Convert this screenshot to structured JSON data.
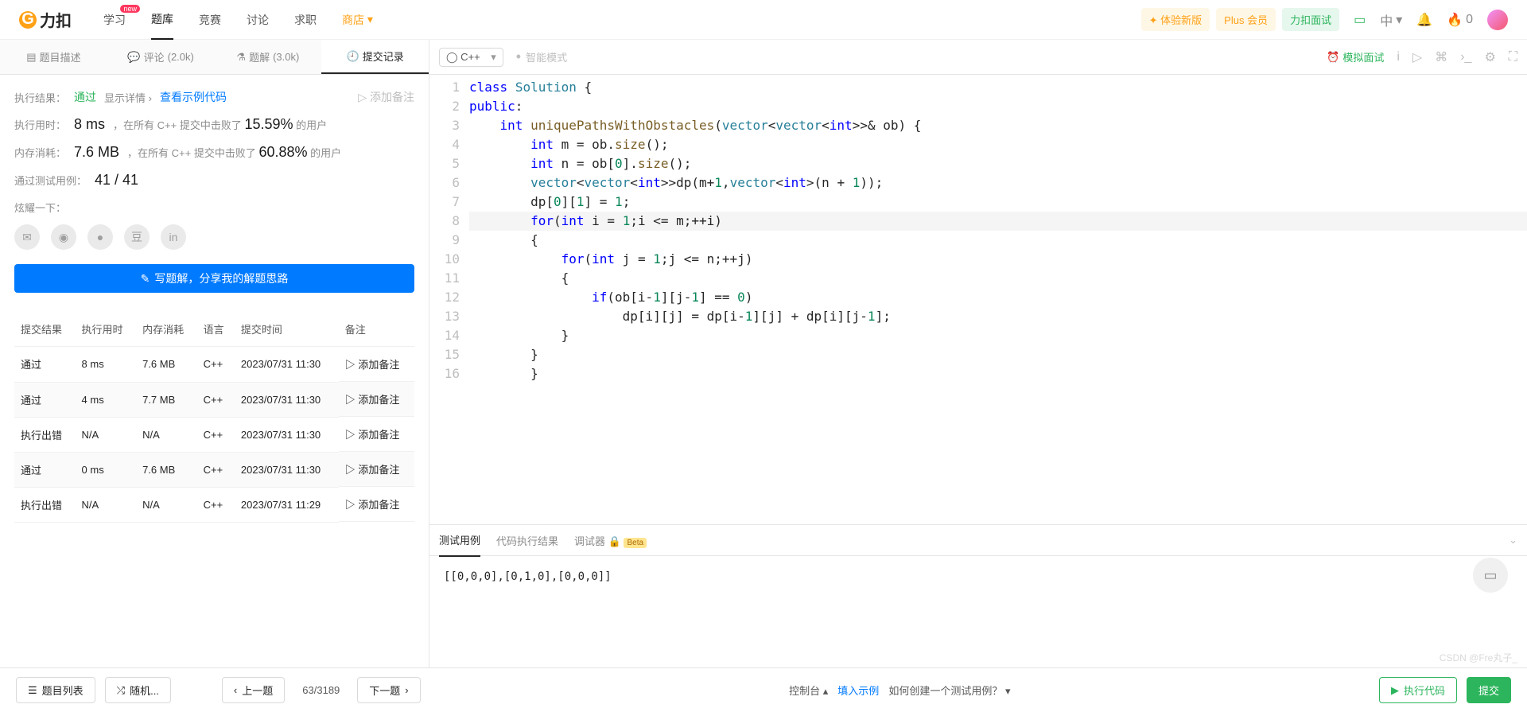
{
  "nav": {
    "logo": "力扣",
    "items": [
      "学习",
      "题库",
      "竞赛",
      "讨论",
      "求职",
      "商店"
    ],
    "badge_new": "new",
    "store_caret": "▾",
    "trial": "体验新版",
    "plus": "Plus 会员",
    "interview": "力扣面试",
    "lang": "中",
    "fire": "0"
  },
  "left_tabs": {
    "desc": "题目描述",
    "comment": "评论",
    "comment_count": "(2.0k)",
    "solution": "题解",
    "solution_count": "(3.0k)",
    "submissions": "提交记录"
  },
  "result": {
    "label_result": "执行结果：",
    "value_result": "通过",
    "show_detail": "显示详情",
    "example_code": "查看示例代码",
    "add_note_top": "添加备注",
    "label_time": "执行用时：",
    "time": "8 ms",
    "time_text_a": "，在所有 C++ 提交中击败了",
    "time_pct": "15.59%",
    "time_text_b": "的用户",
    "label_memory": "内存消耗：",
    "memory": "7.6 MB",
    "mem_text_a": "，在所有 C++ 提交中击败了",
    "mem_pct": "60.88%",
    "mem_text_b": "的用户",
    "label_tests": "通过测试用例：",
    "tests": "41 / 41",
    "show_off": "炫耀一下：",
    "write_solution": "写题解，分享我的解题思路"
  },
  "table": {
    "headers": [
      "提交结果",
      "执行用时",
      "内存消耗",
      "语言",
      "提交时间",
      "备注"
    ],
    "rows": [
      {
        "status": "通过",
        "ok": true,
        "time": "8 ms",
        "mem": "7.6 MB",
        "lang": "C++",
        "ts": "2023/07/31 11:30"
      },
      {
        "status": "通过",
        "ok": true,
        "time": "4 ms",
        "mem": "7.7 MB",
        "lang": "C++",
        "ts": "2023/07/31 11:30"
      },
      {
        "status": "执行出错",
        "ok": false,
        "time": "N/A",
        "mem": "N/A",
        "lang": "C++",
        "ts": "2023/07/31 11:30"
      },
      {
        "status": "通过",
        "ok": true,
        "time": "0 ms",
        "mem": "7.6 MB",
        "lang": "C++",
        "ts": "2023/07/31 11:30"
      },
      {
        "status": "执行出错",
        "ok": false,
        "time": "N/A",
        "mem": "N/A",
        "lang": "C++",
        "ts": "2023/07/31 11:29"
      }
    ],
    "add_note": "添加备注"
  },
  "editor": {
    "language": "C++",
    "smart_mode": "智能模式",
    "mock": "模拟面试",
    "lines": [
      "class Solution {",
      "public:",
      "    int uniquePathsWithObstacles(vector<vector<int>>& ob) {",
      "        int m = ob.size();",
      "        int n = ob[0].size();",
      "        vector<vector<int>>dp(m+1,vector<int>(n + 1));",
      "        dp[0][1] = 1;",
      "        for(int i = 1;i <= m;++i)",
      "        {",
      "            for(int j = 1;j <= n;++j)",
      "            {",
      "                if(ob[i-1][j-1] == 0)",
      "                    dp[i][j] = dp[i-1][j] + dp[i][j-1];",
      "            }",
      "        }",
      "        }"
    ]
  },
  "bottom_tabs": {
    "testcase": "测试用例",
    "run_result": "代码执行结果",
    "debugger": "调试器",
    "beta": "Beta"
  },
  "testcase_content": "[[0,0,0],[0,1,0],[0,0,0]]",
  "bottom": {
    "problem_list": "题目列表",
    "random": "随机...",
    "prev": "上一题",
    "next": "下一题",
    "page": "63/3189",
    "console": "控制台",
    "fill_example": "填入示例",
    "how_create": "如何创建一个测试用例？",
    "run": "执行代码",
    "submit": "提交"
  },
  "watermark": "CSDN @Fre丸子_"
}
